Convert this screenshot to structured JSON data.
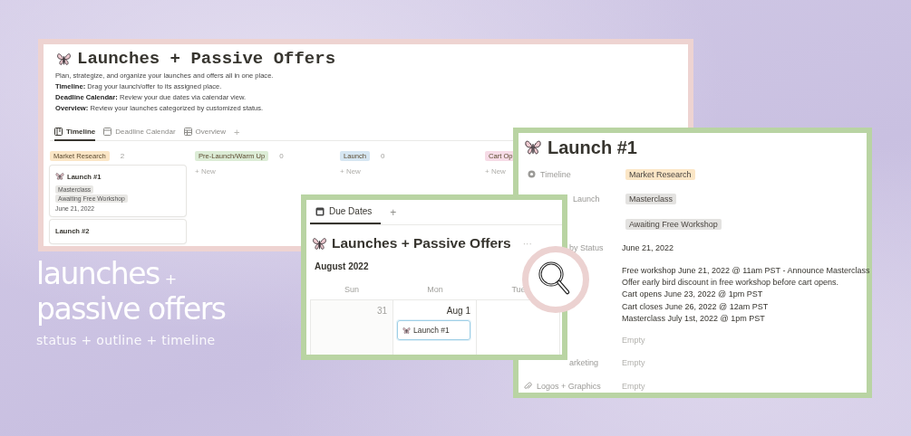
{
  "promo": {
    "title_first": "launches",
    "plus": "+",
    "title_second": "passive offers",
    "subtitle": "status + outline + timeline"
  },
  "board": {
    "title": "Launches + Passive Offers",
    "description": [
      "Plan, strategize, and organize your launches and offers all in one place.",
      "**Timeline:** Drag your launch/offer to its assigned place.",
      "**Deadline Calendar:** Review your due dates via calendar view.",
      "**Overview:** Review your launches categorized by customized status."
    ],
    "tabs": [
      {
        "label": "Timeline",
        "selected": true
      },
      {
        "label": "Deadline Calendar",
        "selected": false
      },
      {
        "label": "Overview",
        "selected": false
      }
    ],
    "add_view": "+",
    "columns": [
      {
        "name": "Market Research",
        "color": "#fbe6c6",
        "count": "2",
        "cards": [
          {
            "title": "Launch #1",
            "icon": true,
            "tags": [
              "Masterclass",
              "Awaiting Free Workshop"
            ],
            "date": "June 21, 2022"
          },
          {
            "title": "Launch #2",
            "icon": false
          }
        ]
      },
      {
        "name": "Pre-Launch/Warm Up",
        "color": "#dcecd6",
        "count": "0",
        "new": "+ New"
      },
      {
        "name": "Launch",
        "color": "#d6e6f2",
        "count": "0",
        "new": "+ New"
      },
      {
        "name": "Cart Op",
        "color": "#f6dbe6",
        "new": "+ New"
      }
    ]
  },
  "calendar": {
    "tabs": [
      {
        "label": "Due Dates",
        "selected": true
      }
    ],
    "add_view": "+",
    "title": "Launches + Passive Offers",
    "more": "···",
    "month": "August 2022",
    "weekdays": [
      "Sun",
      "Mon",
      "Tue"
    ],
    "days": [
      {
        "label": "31",
        "current_month": false
      },
      {
        "label": "Aug 1",
        "current_month": true,
        "events": [
          {
            "title": "Launch #1"
          }
        ]
      }
    ]
  },
  "detail": {
    "title": "Launch #1",
    "properties": [
      {
        "label": "Timeline",
        "covered": false,
        "value": {
          "kind": "tag",
          "text": "Market Research",
          "color": "#fbe6c6"
        }
      },
      {
        "label": "Launch",
        "covered": true,
        "value": {
          "kind": "tag",
          "text": "Masterclass",
          "color": "#e3e2e0"
        }
      },
      {
        "value": {
          "kind": "tag",
          "text": "Awaiting Free Workshop",
          "color": "#e3e2e0"
        }
      },
      {
        "label": "by Status",
        "covered": true,
        "value": {
          "kind": "text",
          "text": "June 21, 2022"
        }
      },
      {
        "value": {
          "kind": "lines",
          "lines": [
            "Free workshop June 21, 2022 @ 11am PST - Announce Masterclass",
            "Offer early bird discount in free workshop before cart opens.",
            "Cart opens June 23, 2022 @ 1pm PST",
            "Cart closes June 26, 2022 @ 12am PST",
            "Masterclass July 1st, 2022 @ 1pm PST"
          ]
        }
      },
      {
        "value": {
          "kind": "empty",
          "text": "Empty"
        }
      },
      {
        "label": "arketing",
        "covered": true,
        "value": {
          "kind": "empty",
          "text": "Empty"
        }
      },
      {
        "label": "Logos + Graphics",
        "covered": false,
        "value": {
          "kind": "empty",
          "text": "Empty"
        }
      }
    ]
  }
}
